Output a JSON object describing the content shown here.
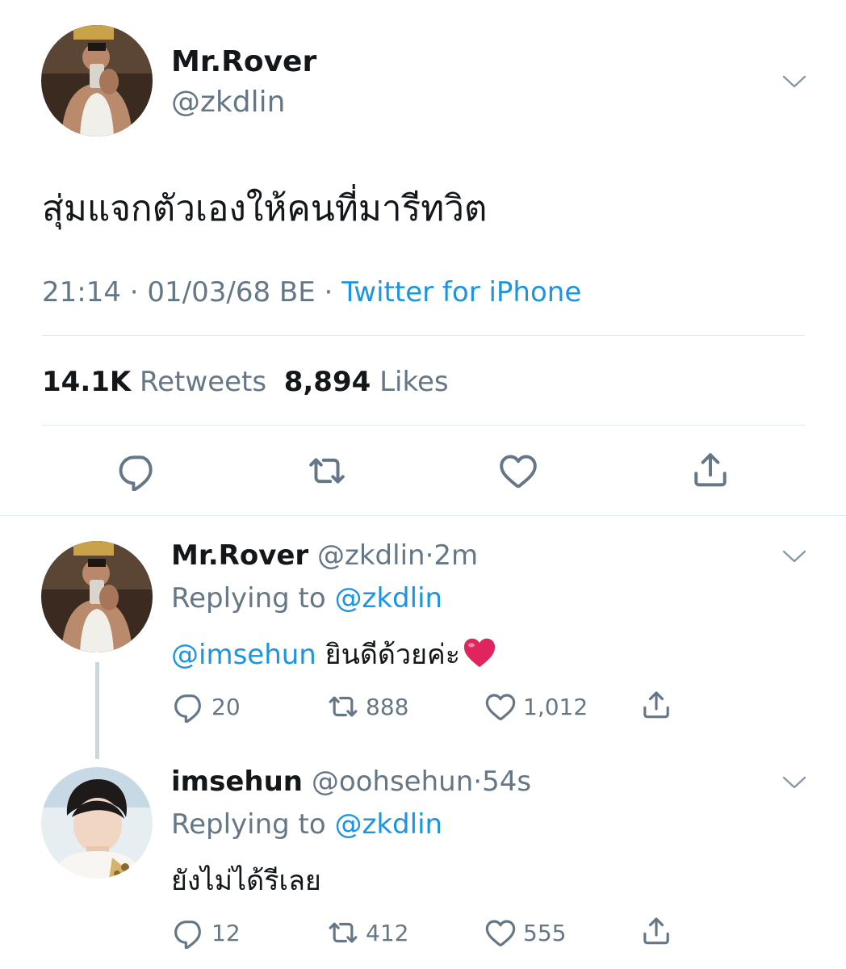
{
  "main_tweet": {
    "name": "Mr.Rover",
    "handle": "@zkdlin",
    "text": "สุ่มแจกตัวเองให้คนที่มารีทวิต",
    "time": "21:14 · 01/03/68 BE · ",
    "source": "Twitter for iPhone",
    "retweets_count": "14.1K",
    "retweets_label": "Retweets",
    "likes_count": "8,894",
    "likes_label": "Likes"
  },
  "replies": [
    {
      "name": "Mr.Rover",
      "handle": "@zkdlin",
      "time": "2m",
      "replying_prefix": "Replying to ",
      "replying_to": "@zkdlin",
      "mention": "@imsehun",
      "text": "ยินดีด้วยค่ะ",
      "emoji": "❤️",
      "reply_count": "20",
      "retweet_count": "888",
      "like_count": "1,012"
    },
    {
      "name": "imsehun",
      "handle": "@oohsehun",
      "time": "54s",
      "replying_prefix": "Replying to ",
      "replying_to": "@zkdlin",
      "text": "ยังไม่ได้รีเลย",
      "reply_count": "12",
      "retweet_count": "412",
      "like_count": "555"
    }
  ],
  "colors": {
    "text": "#14171a",
    "muted": "#657786",
    "link": "#1b95e0",
    "divider": "#e1e8ed",
    "heart": "#e0245e"
  },
  "icons": [
    "chevron-down-icon",
    "reply-icon",
    "retweet-icon",
    "like-icon",
    "share-icon"
  ]
}
